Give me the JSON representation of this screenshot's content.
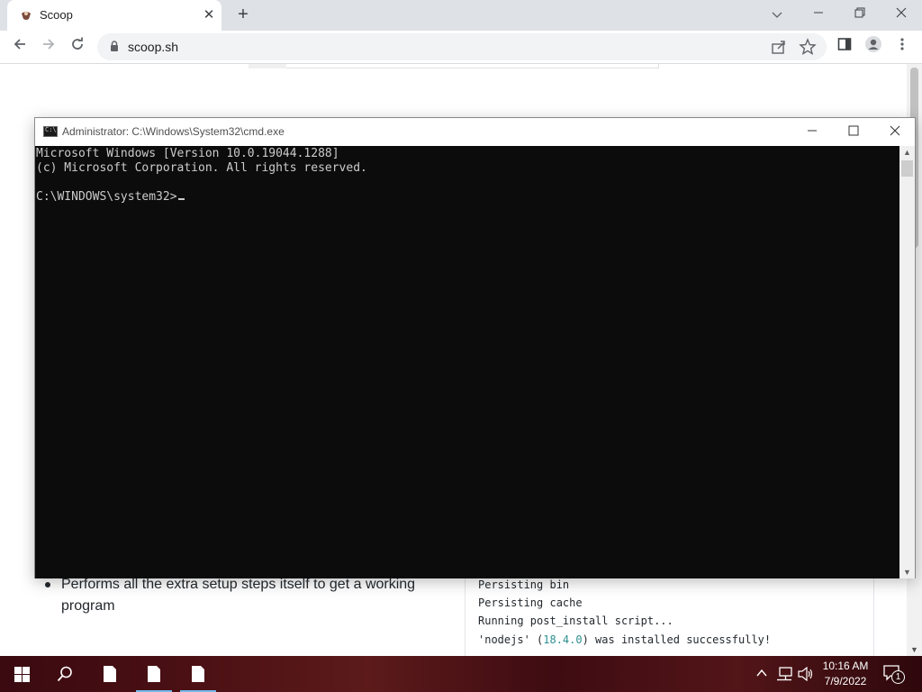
{
  "browser": {
    "tab_title": "Scoop",
    "url": "scoop.sh"
  },
  "page": {
    "feature_text": "Performs all the extra setup steps itself to get a working program",
    "code_lines": [
      {
        "text": "Persisting bin"
      },
      {
        "text": "Persisting cache"
      },
      {
        "text": "Running post_install script..."
      }
    ],
    "install_line": {
      "prefix": "'nodejs' (",
      "version": "18.4.0",
      "suffix": ") was installed successfully!"
    }
  },
  "cmd": {
    "title": "Administrator: C:\\Windows\\System32\\cmd.exe",
    "icon_label": "C:\\",
    "lines": [
      "Microsoft Windows [Version 10.0.19044.1288]",
      "(c) Microsoft Corporation. All rights reserved.",
      "",
      "C:\\WINDOWS\\system32>"
    ]
  },
  "taskbar": {
    "time": "10:16 AM",
    "date": "7/9/2022",
    "notification_count": "1"
  },
  "colors": {
    "console_bg": "#0c0c0c",
    "console_text": "#cccccc",
    "taskbar_accent": "#76b9ed"
  }
}
